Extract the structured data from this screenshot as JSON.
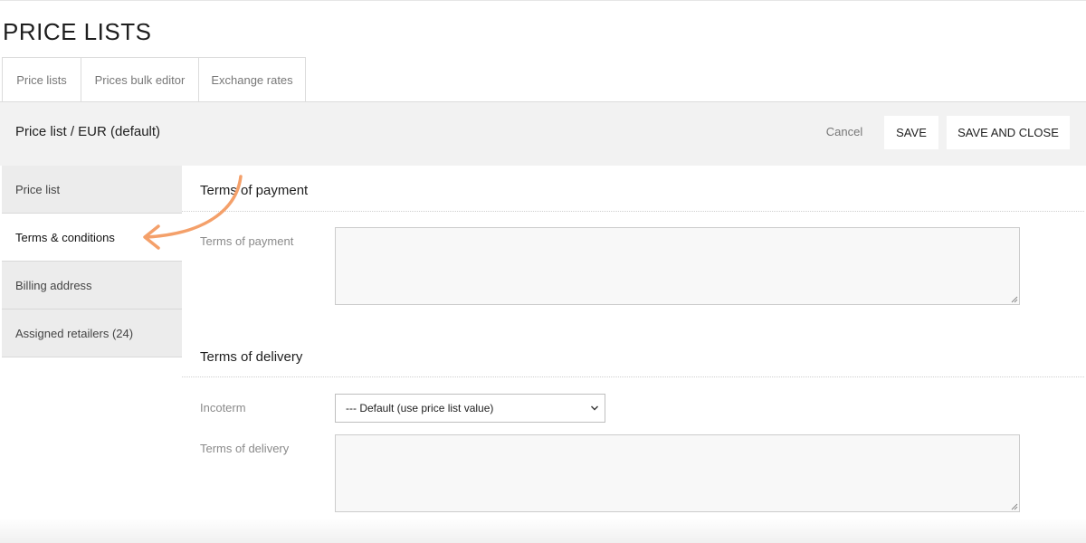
{
  "page": {
    "title": "PRICE LISTS"
  },
  "tabs": [
    {
      "label": "Price lists"
    },
    {
      "label": "Prices bulk editor"
    },
    {
      "label": "Exchange rates"
    }
  ],
  "header": {
    "breadcrumb": "Price list / EUR (default)",
    "cancel_label": "Cancel",
    "save_label": "SAVE",
    "save_close_label": "SAVE AND CLOSE"
  },
  "sidebar": {
    "items": [
      {
        "label": "Price list",
        "active": false
      },
      {
        "label": "Terms & conditions",
        "active": true
      },
      {
        "label": "Billing address",
        "active": false
      },
      {
        "label": "Assigned retailers (24)",
        "active": false
      }
    ]
  },
  "payment_section": {
    "title": "Terms of payment",
    "field_label": "Terms of payment",
    "value": ""
  },
  "delivery_section": {
    "title": "Terms of delivery",
    "incoterm_label": "Incoterm",
    "incoterm_selected": "--- Default (use price list value)",
    "delivery_label": "Terms of delivery",
    "delivery_value": ""
  },
  "annotation": {
    "arrow_color": "#f4a06a",
    "arrow_icon": "curved-arrow-icon"
  },
  "colors": {
    "header_bg": "#f2f2f2",
    "sidebar_bg": "#ececec",
    "active_bg": "#ffffff"
  }
}
